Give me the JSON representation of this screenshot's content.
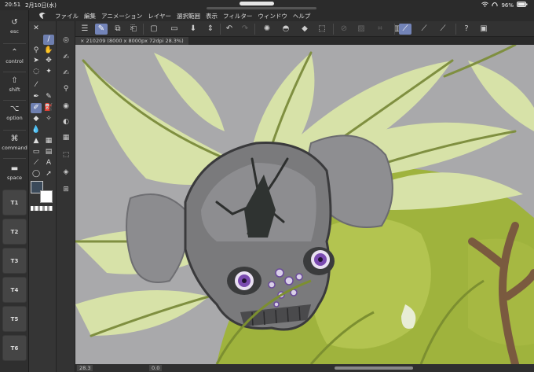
{
  "statusbar": {
    "time": "20:51",
    "date": "2月10日(水)",
    "battery": "96%"
  },
  "menu": {
    "items": [
      "ファイル",
      "編集",
      "アニメーション",
      "レイヤー",
      "選択範囲",
      "表示",
      "フィルター",
      "ウィンドウ",
      "ヘルプ"
    ]
  },
  "modifiers": {
    "esc": "esc",
    "control": "control",
    "shift": "shift",
    "option": "option",
    "command": "command",
    "space": "space"
  },
  "tkeys": [
    "T1",
    "T2",
    "T3",
    "T4",
    "T5",
    "T6"
  ],
  "document": {
    "tab_label": "210209 (8000 x 8000px 72dpi 28.3%)",
    "close": "×"
  },
  "bottom": {
    "zoom": "28.3",
    "rotation": "0.0"
  },
  "colors": {
    "canvas_bg": "#a9a9ab",
    "accent": "#7384b8",
    "main_color": "#3b4a5a",
    "sub_color": "#ffffff"
  },
  "icons": {
    "menu": "hamburger-icon",
    "undo": "undo-icon",
    "redo": "redo-icon"
  }
}
